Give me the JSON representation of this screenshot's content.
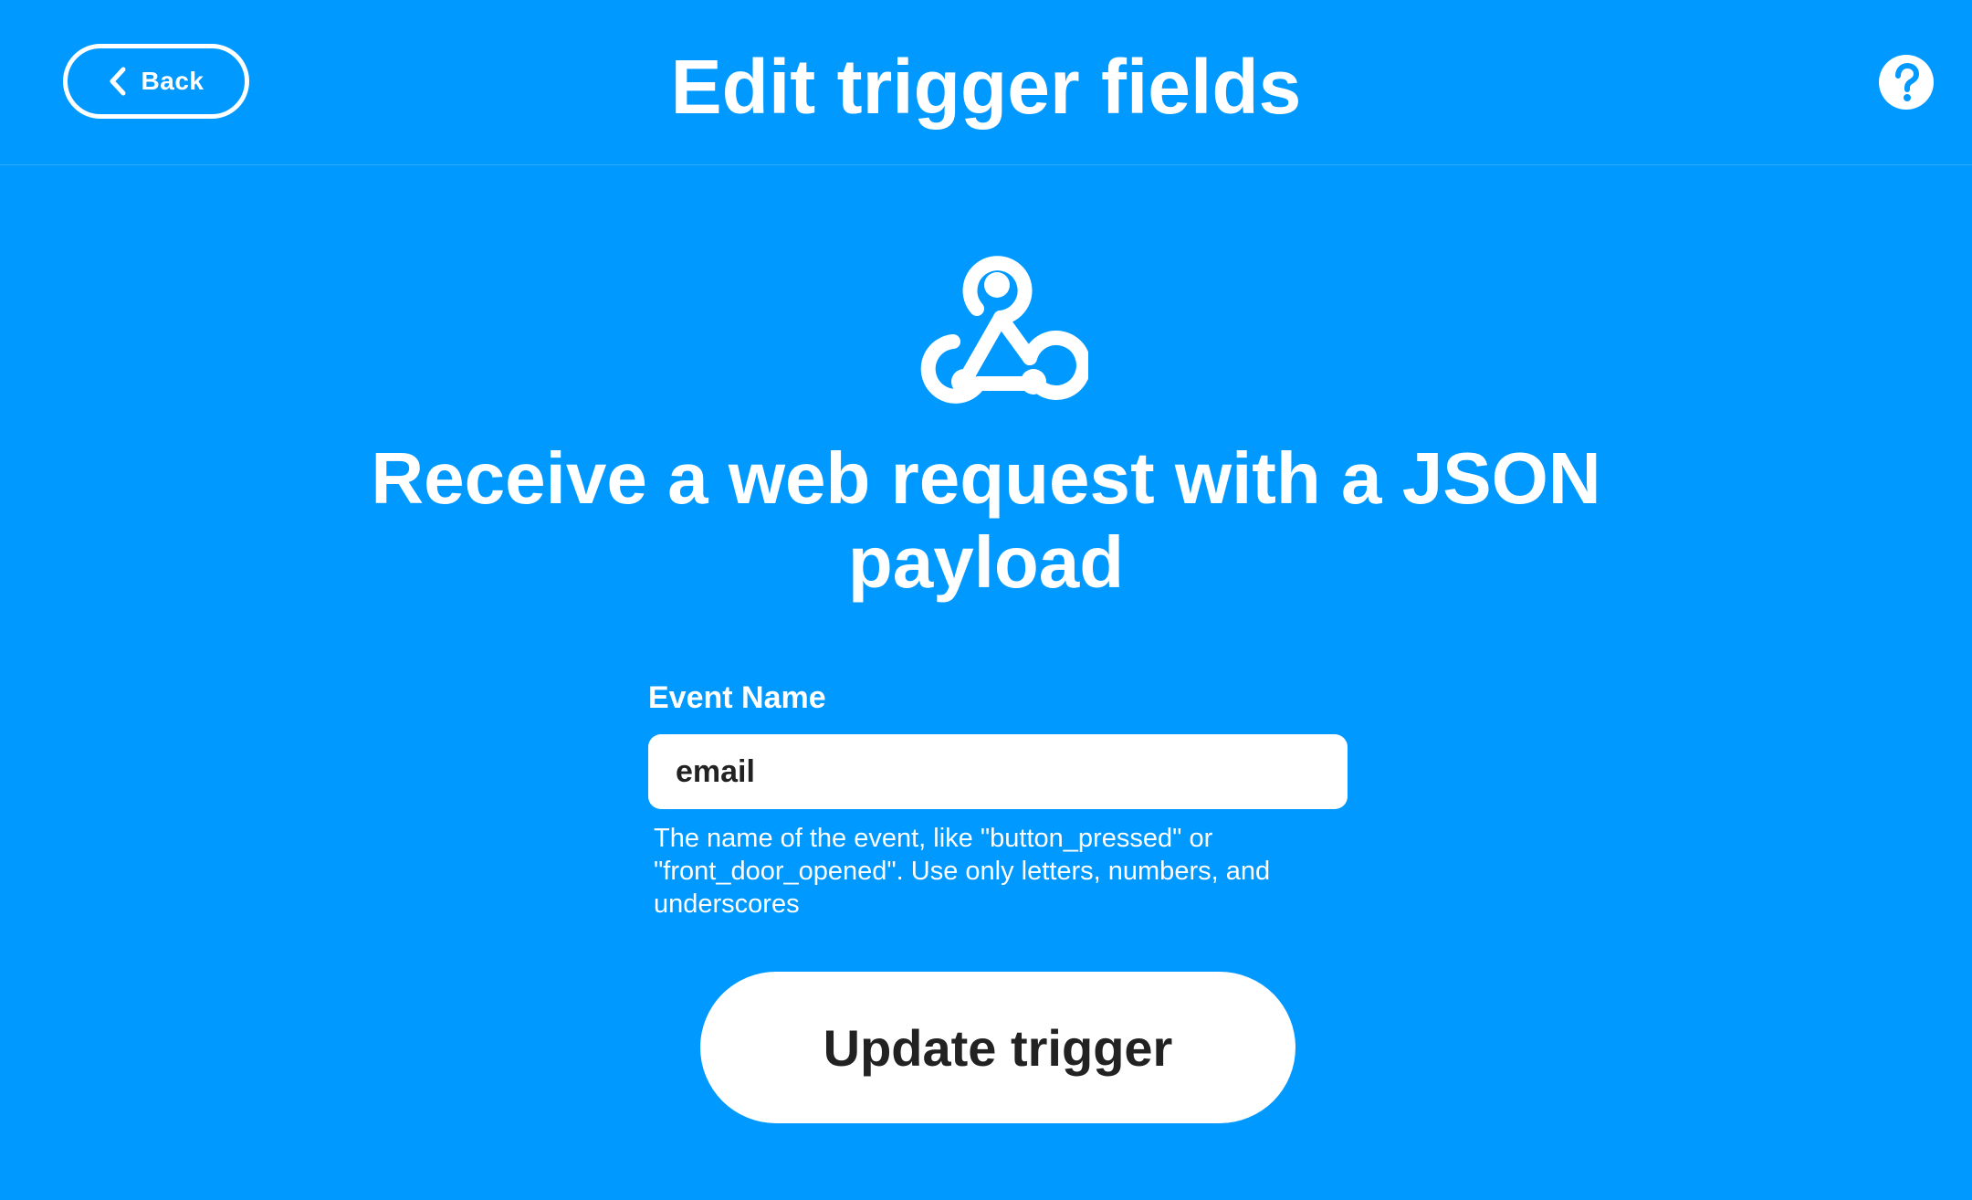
{
  "header": {
    "back_label": "Back",
    "title": "Edit trigger fields",
    "help_icon": "question-mark-icon"
  },
  "service": {
    "icon": "webhooks-icon",
    "trigger_title": "Receive a web request with a JSON payload"
  },
  "form": {
    "event_name": {
      "label": "Event Name",
      "value": "email",
      "help_text": "The name of the event, like \"button_pressed\" or \"front_door_opened\". Use only letters, numbers, and underscores"
    }
  },
  "actions": {
    "update_label": "Update trigger"
  },
  "colors": {
    "background": "#0099ff",
    "foreground": "#ffffff",
    "button_text": "#222222"
  }
}
